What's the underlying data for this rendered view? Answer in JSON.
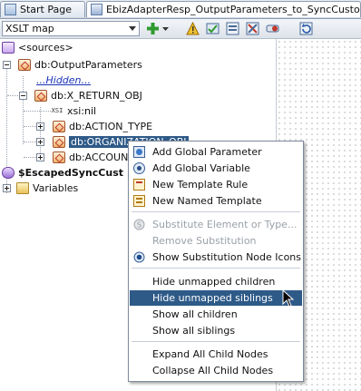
{
  "tabs": [
    {
      "label": "Start Page",
      "icon": "start-page-icon"
    },
    {
      "label": "EbizAdapterResp_OutputParameters_to_SyncCustom",
      "icon": "xsl-file-icon"
    }
  ],
  "toolbar": {
    "map_select_value": "XSLT map",
    "icons": [
      "add-icon",
      "dropdown-arrow-icon",
      "warning-icon",
      "validate-icon",
      "test-icon",
      "xslt-icon",
      "toggle-icon",
      "refresh-icon"
    ]
  },
  "tree": {
    "root_label": "<sources>",
    "output_parameters": "db:OutputParameters",
    "hidden_link": "...Hidden...",
    "x_return_obj": "db:X_RETURN_OBJ",
    "xsi_nil": "xsi:nil",
    "attr_icon_text": "XSI",
    "action_type": "db:ACTION_TYPE",
    "organization_obj": "db:ORGANIZATION_OBJ",
    "account": "db:ACCOUNT",
    "escaped": "$EscapedSyncCust",
    "variables": "Variables"
  },
  "context_menu": {
    "items": [
      {
        "label": "Add Global Parameter",
        "icon": "global-parameter-icon",
        "enabled": true
      },
      {
        "label": "Add Global Variable",
        "icon": "global-variable-icon",
        "enabled": true
      },
      {
        "label": "New Template Rule",
        "icon": "template-rule-icon",
        "enabled": true
      },
      {
        "label": "New Named Template",
        "icon": "named-template-icon",
        "enabled": true
      },
      {
        "label": "Substitute Element or Type...",
        "icon": "substitute-icon",
        "enabled": false
      },
      {
        "label": "Remove Substitution",
        "icon": "",
        "enabled": false
      },
      {
        "label": "Show Substitution Node Icons",
        "icon": "radio-selected-icon",
        "enabled": true
      },
      {
        "label": "Hide unmapped children",
        "icon": "",
        "enabled": true
      },
      {
        "label": "Hide unmapped siblings",
        "icon": "",
        "enabled": true,
        "highlighted": true
      },
      {
        "label": "Show all children",
        "icon": "",
        "enabled": true
      },
      {
        "label": "Show all siblings",
        "icon": "",
        "enabled": true
      },
      {
        "label": "Expand All Child Nodes",
        "icon": "",
        "enabled": true
      },
      {
        "label": "Collapse All Child Nodes",
        "icon": "",
        "enabled": true
      }
    ]
  },
  "colors": {
    "selection": "#2e5a88",
    "link": "#1a33b8",
    "disabled_text": "#9aa0a8"
  }
}
